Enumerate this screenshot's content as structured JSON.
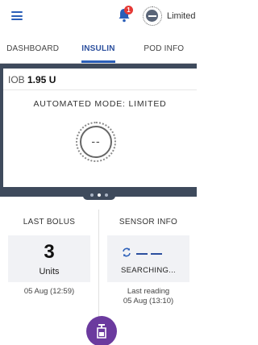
{
  "header": {
    "notification_count": "1",
    "mode_label": "Limited"
  },
  "tabs": [
    {
      "label": "DASHBOARD"
    },
    {
      "label": "INSULIN"
    },
    {
      "label": "POD INFO"
    }
  ],
  "iob": {
    "label": "IOB",
    "value": "1.95 U"
  },
  "mode": {
    "title": "AUTOMATED MODE: LIMITED",
    "indicator": "--"
  },
  "last_bolus": {
    "title": "LAST BOLUS",
    "amount": "3",
    "unit": "Units",
    "time": "05 Aug (12:59)"
  },
  "sensor": {
    "title": "SENSOR INFO",
    "status": "SEARCHING...",
    "footer_line1": "Last reading",
    "footer_line2": "05 Aug (13:10)"
  },
  "colors": {
    "accent": "#2b5fb8",
    "band": "#3e4a5c",
    "fab": "#6b3a9e",
    "badge": "#e53935"
  },
  "icons": [
    "menu-icon",
    "bell-icon",
    "automated-mode-icon",
    "sync-icon",
    "bolus-icon"
  ]
}
